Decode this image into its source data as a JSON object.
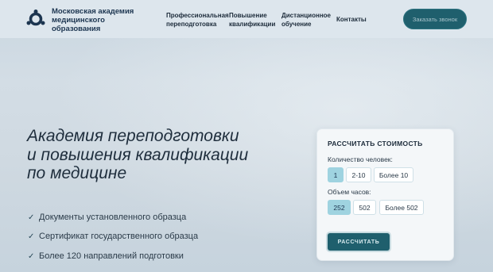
{
  "header": {
    "logo_text": "Московская академия медицинского образования",
    "nav": [
      "Профессиональная переподготовка",
      "Повышение квалификации",
      "Дистанционное обучение",
      "Контакты"
    ],
    "call_button": "Заказать звонок"
  },
  "hero": {
    "title": "Академия переподготовки и повышения квалификации по медицине",
    "features": [
      "Документы установленного образца",
      "Сертификат государственного образца",
      "Более 120 направлений подготовки"
    ]
  },
  "calculator": {
    "title": "РАССЧИТАТЬ СТОИМОСТЬ",
    "people_label": "Количество человек:",
    "people_options": [
      "1",
      "2-10",
      "Более 10"
    ],
    "people_selected": "1",
    "hours_label": "Объем часов:",
    "hours_options": [
      "252",
      "502",
      "Более 502"
    ],
    "hours_selected": "252",
    "button": "РАССЧИТАТЬ"
  },
  "colors": {
    "accent": "#1f5f6d",
    "selected_option": "#9fd3e0"
  }
}
